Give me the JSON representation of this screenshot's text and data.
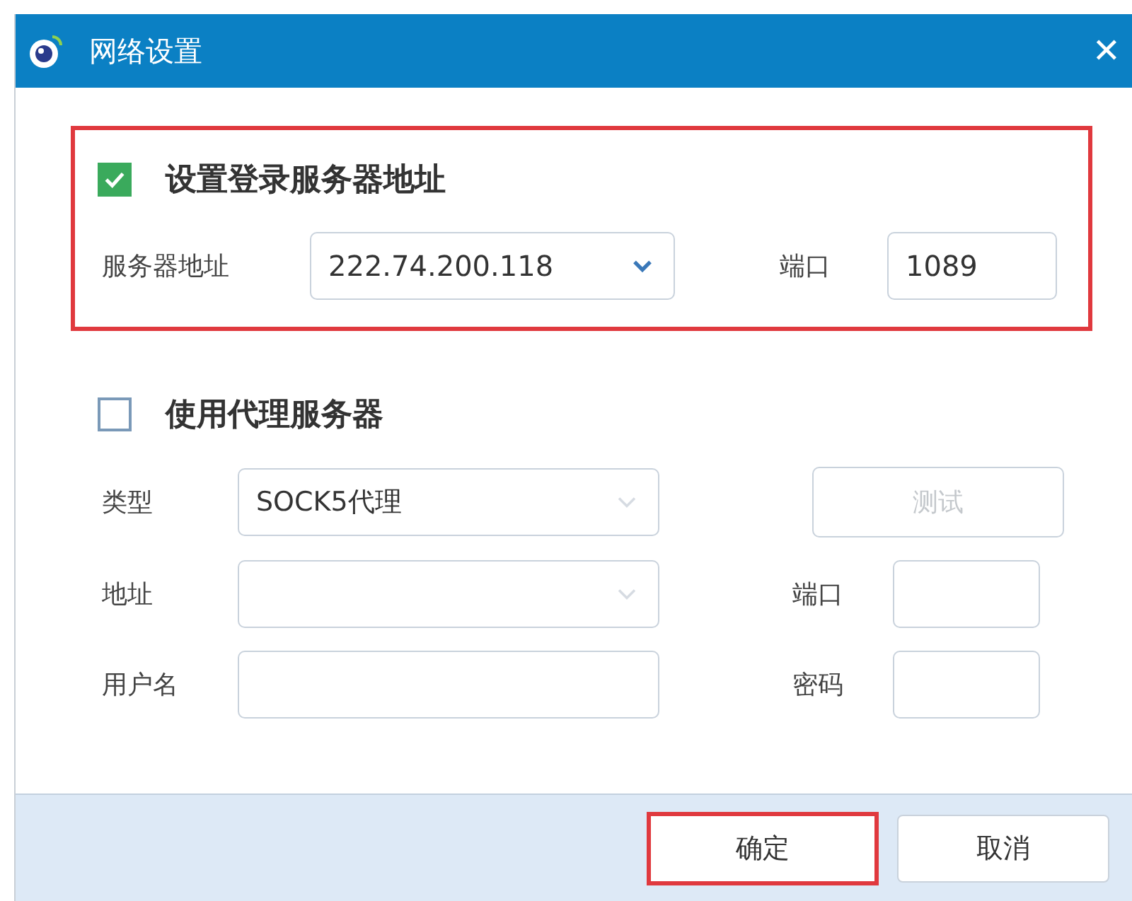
{
  "window": {
    "title": "网络设置",
    "close": "✕"
  },
  "server_section": {
    "label": "设置登录服务器地址",
    "checked": true,
    "highlighted": true,
    "address_label": "服务器地址",
    "address": "222.74.200.118",
    "port_label": "端口",
    "port": "1089"
  },
  "proxy_section": {
    "label": "使用代理服务器",
    "checked": false,
    "type_label": "类型",
    "type": "SOCK5代理",
    "test_button": {
      "label": "测试",
      "disabled": true
    },
    "address_label": "地址",
    "port_label": "端口",
    "username_label": "用户名",
    "password_label": "密码"
  },
  "buttons": [
    {
      "label": "确定",
      "highlighted": true
    },
    {
      "label": "取消",
      "highlighted": false
    }
  ]
}
